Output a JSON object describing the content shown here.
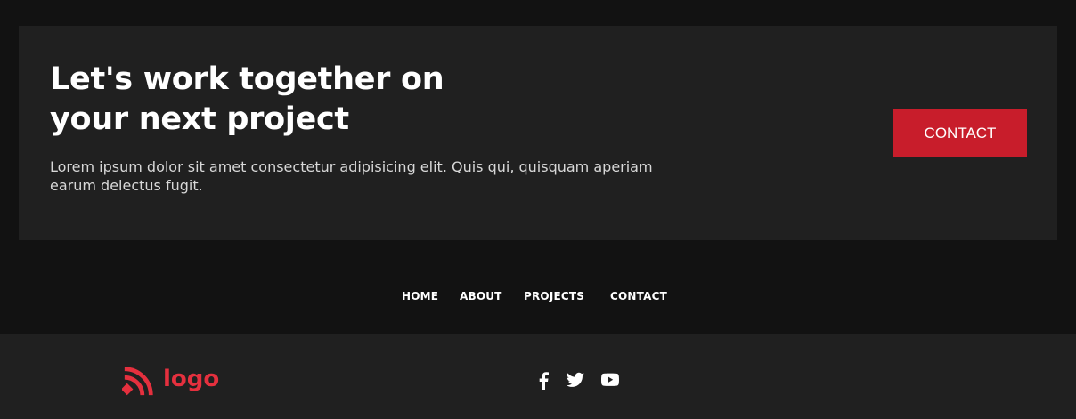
{
  "cta": {
    "heading": "Let's work together on your next project",
    "text": "Lorem ipsum dolor sit amet consectetur adipisicing elit. Quis qui, quisquam aperiam earum delectus fugit.",
    "button_label": "CONTACT"
  },
  "nav": {
    "items": [
      "HOME",
      "ABOUT",
      "PROJECTS",
      "CONTACT"
    ]
  },
  "footer": {
    "logo_text": "logo",
    "social_icons": [
      "facebook-icon",
      "twitter-icon",
      "youtube-icon"
    ]
  },
  "colors": {
    "background": "#121212",
    "panel": "#202020",
    "accent": "#c81d2b",
    "logo": "#e5303e"
  }
}
